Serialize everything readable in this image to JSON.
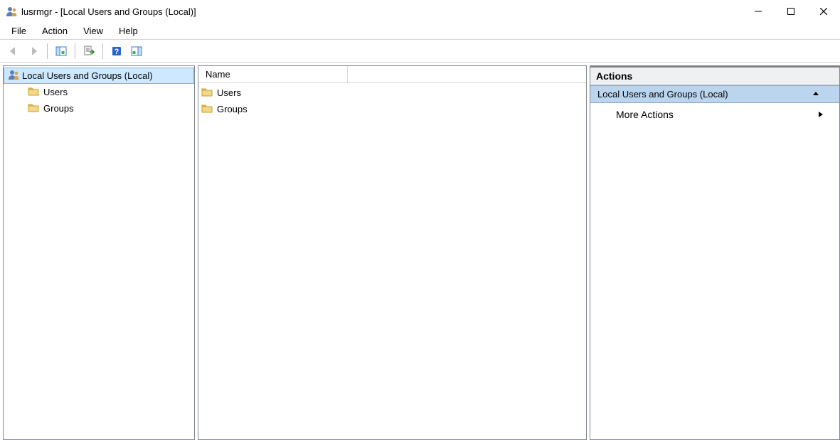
{
  "window": {
    "title": "lusrmgr - [Local Users and Groups (Local)]"
  },
  "menus": {
    "file": "File",
    "action": "Action",
    "view": "View",
    "help": "Help"
  },
  "toolbar": {
    "back": "back-icon",
    "forward": "forward-icon",
    "show_hide": "panes-icon",
    "export": "export-icon",
    "help": "help-icon",
    "action_pane": "action-pane-icon"
  },
  "tree": {
    "root_label": "Local Users and Groups (Local)",
    "items": [
      {
        "label": "Users"
      },
      {
        "label": "Groups"
      }
    ]
  },
  "list": {
    "columns": {
      "name": "Name"
    },
    "rows": [
      {
        "name": "Users"
      },
      {
        "name": "Groups"
      }
    ]
  },
  "actions": {
    "header": "Actions",
    "section_label": "Local Users and Groups (Local)",
    "more_actions": "More Actions"
  }
}
